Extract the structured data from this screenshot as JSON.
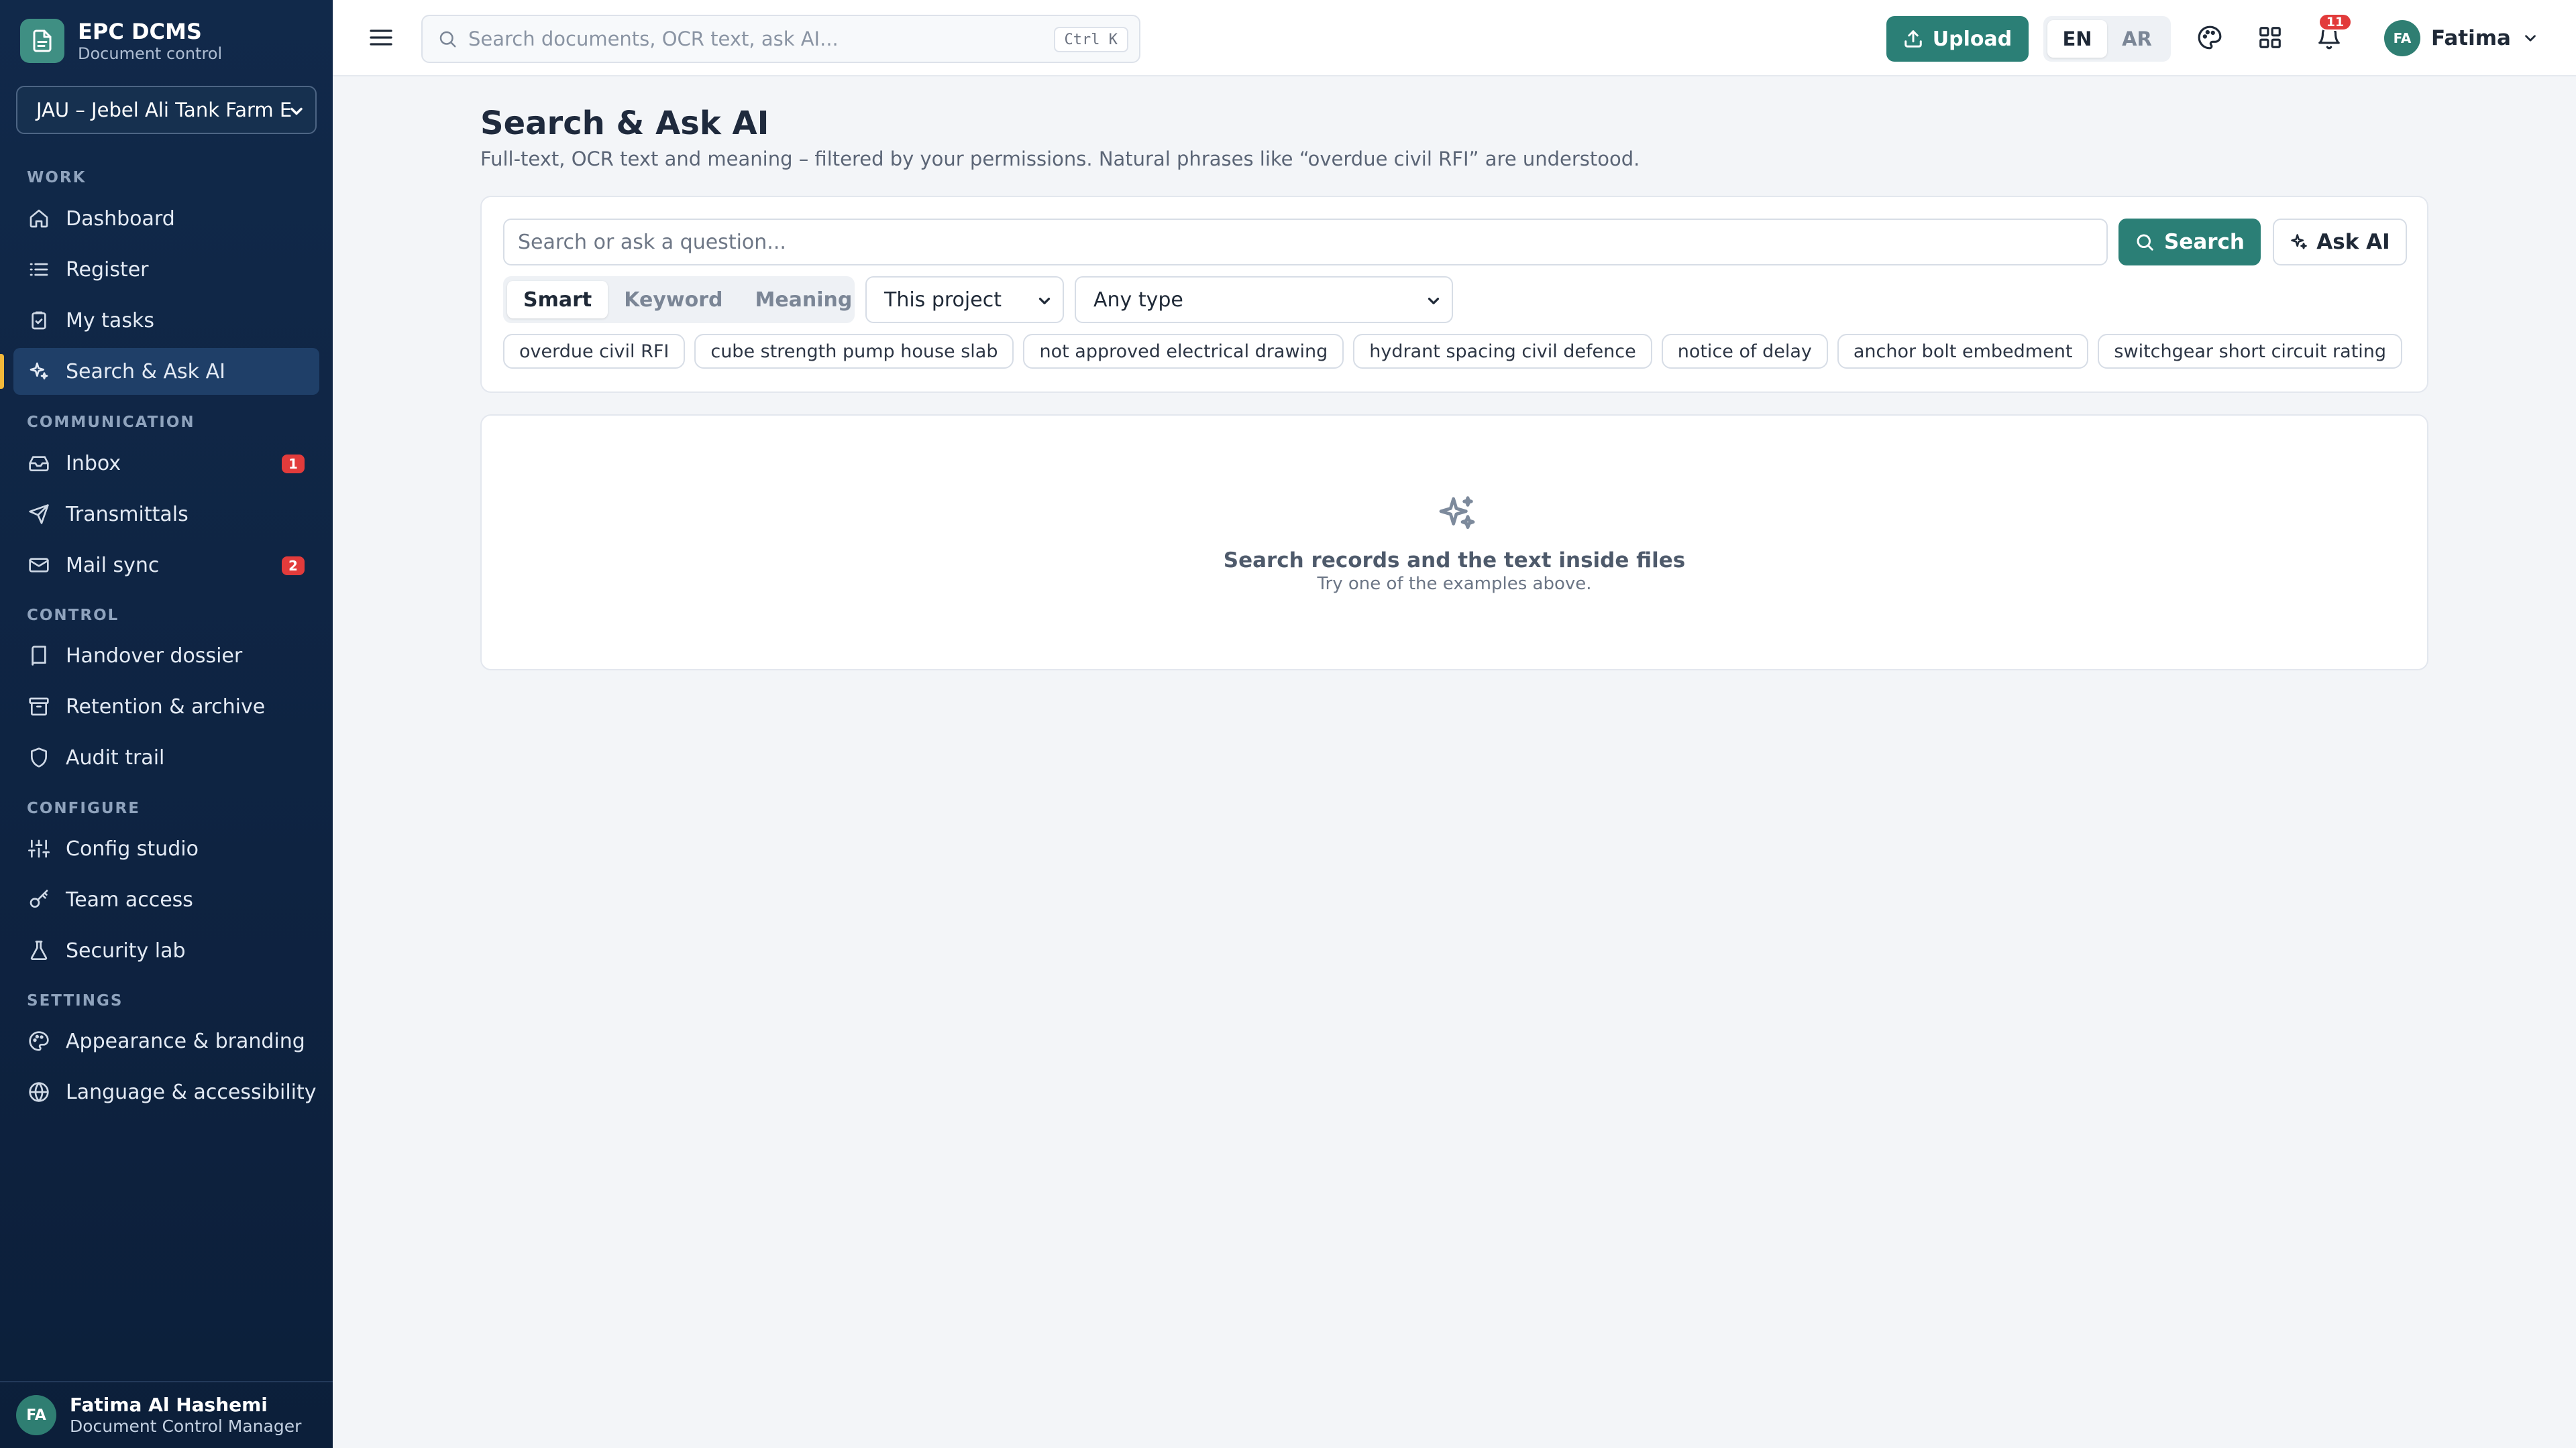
{
  "brand": {
    "name": "EPC DCMS",
    "subtitle": "Document control"
  },
  "project_selector": {
    "value": "JAU – Jebel Ali Tank Farm E"
  },
  "sidebar": {
    "sections": {
      "work": "WORK",
      "communication": "COMMUNICATION",
      "control": "CONTROL",
      "configure": "CONFIGURE",
      "settings": "SETTINGS"
    },
    "items": {
      "dashboard": "Dashboard",
      "register": "Register",
      "my_tasks": "My tasks",
      "search_ask_ai": "Search & Ask AI",
      "inbox": "Inbox",
      "inbox_badge": "1",
      "transmittals": "Transmittals",
      "mail_sync": "Mail sync",
      "mail_sync_badge": "2",
      "handover_dossier": "Handover dossier",
      "retention_archive": "Retention & archive",
      "audit_trail": "Audit trail",
      "config_studio": "Config studio",
      "team_access": "Team access",
      "security_lab": "Security lab",
      "appearance_branding": "Appearance & branding",
      "language_accessibility": "Language & accessibility"
    },
    "active_item": "search_ask_ai"
  },
  "current_user": {
    "initials": "FA",
    "full_name": "Fatima Al Hashemi",
    "role": "Document Control Manager",
    "short_name": "Fatima"
  },
  "topbar": {
    "search_placeholder": "Search documents, OCR text, ask AI...",
    "shortcut": "Ctrl K",
    "upload_label": "Upload",
    "languages": [
      "EN",
      "AR"
    ],
    "active_language": "EN",
    "notification_count": "11"
  },
  "page": {
    "title": "Search & Ask AI",
    "subtitle": "Full-text, OCR text and meaning – filtered by your permissions. Natural phrases like “overdue civil RFI” are understood."
  },
  "search_panel": {
    "query_placeholder": "Search or ask a question...",
    "search_label": "Search",
    "ask_ai_label": "Ask AI",
    "modes": [
      "Smart",
      "Keyword",
      "Meaning"
    ],
    "active_mode": "Smart",
    "scope_value": "This project",
    "type_value": "Any type",
    "examples": [
      "overdue civil RFI",
      "cube strength pump house slab",
      "not approved electrical drawing",
      "hydrant spacing civil defence",
      "notice of delay",
      "anchor bolt embedment",
      "switchgear short circuit rating"
    ]
  },
  "empty_state": {
    "title": "Search records and the text inside files",
    "subtitle": "Try one of the examples above."
  },
  "colors": {
    "sidebar_bg": "#0e2341",
    "accent": "#2b7f76",
    "active_marker": "#f2b83a",
    "badge": "#e23b3b"
  }
}
